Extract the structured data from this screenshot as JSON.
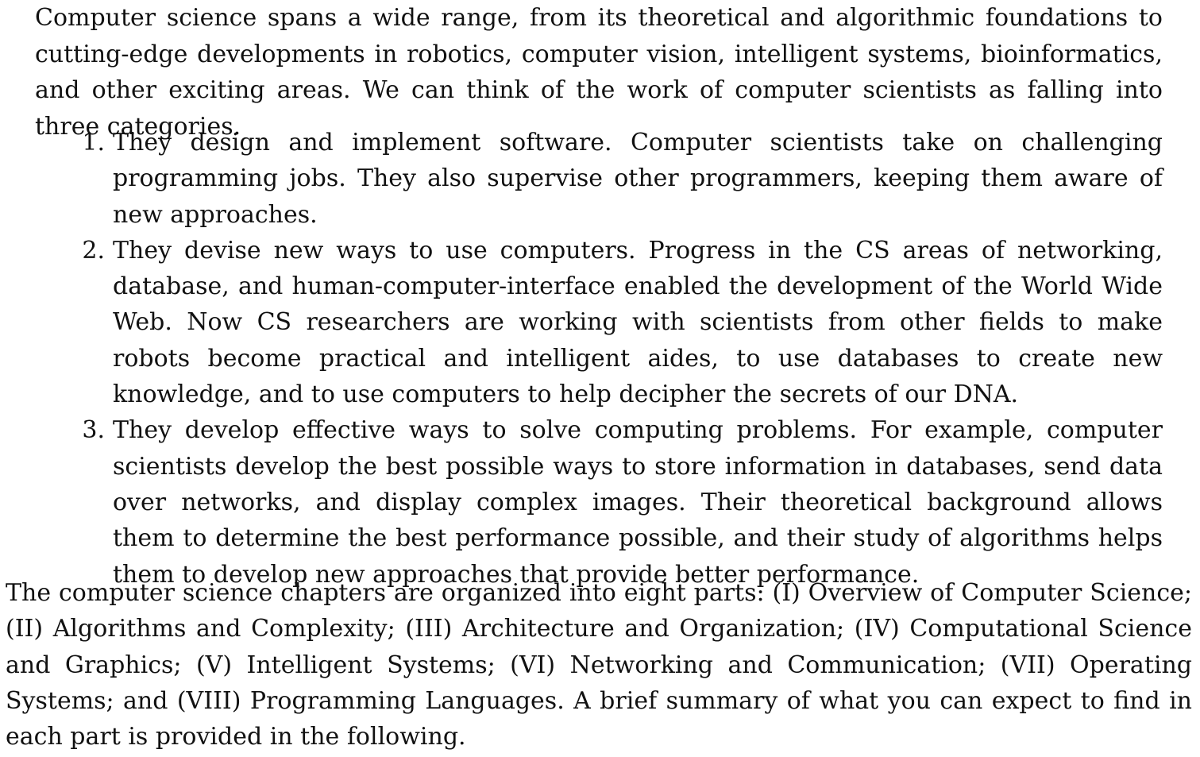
{
  "intro": "Computer science spans a wide range, from its theoretical and algorithmic foundations to cutting-edge developments in robotics, computer vision, intelligent systems, bioinformatics, and other exciting areas. We can think of the work of computer scientists as falling into three categories.",
  "list": [
    {
      "number": "1.",
      "text": "They design and implement software. Computer scientists take on challenging programming jobs. They also supervise other programmers, keeping them aware of new approaches."
    },
    {
      "number": "2.",
      "text": "They devise new ways to use computers. Progress in the CS areas of networking, database, and human-computer-interface enabled the development of the World Wide Web. Now CS researchers are working with scientists from other fields to make robots become practical and intelligent aides, to use databases to create new knowledge, and to use computers to help decipher the secrets of our DNA."
    },
    {
      "number": "3.",
      "text": "They develop effective ways to solve computing problems. For example, computer scientists develop the best possible ways to store information in databases, send data over networks, and display complex images. Their theoretical background allows them to determine the best performance possible, and their study of algorithms helps them to develop new approaches that provide better performance."
    }
  ],
  "closing": "The computer science chapters are organized into eight parts: (I) Overview of Computer Science; (II) Algorithms and Complexity; (III) Architecture and Organization; (IV) Computational Science and Graphics; (V) Intelligent Systems; (VI) Networking and Communication; (VII) Operating Systems; and (VIII) Programming Languages. A brief summary of what you can expect to find in each part is provided in the following."
}
